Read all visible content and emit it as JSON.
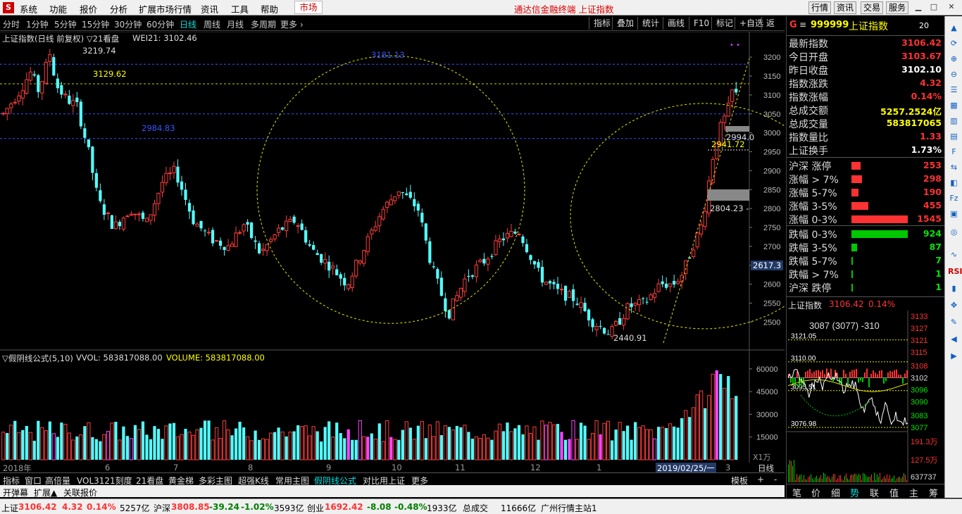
{
  "menu": {
    "logo": "S",
    "items": [
      "系统",
      "功能",
      "报价",
      "分析",
      "扩展市场行情",
      "资讯",
      "工具",
      "帮助"
    ],
    "market": "市场",
    "title": "通达信金融终端  上证指数",
    "right_buttons": [
      "行情",
      "资讯",
      "交易",
      "服务"
    ]
  },
  "periods": [
    "分时",
    "1分钟",
    "5分钟",
    "15分钟",
    "30分钟",
    "60分钟",
    "日线",
    "周线",
    "月线",
    "多周期",
    "更多 ›"
  ],
  "active_period": "日线",
  "chart_tools": [
    "指标",
    "叠加",
    "统计",
    "画线",
    "F10",
    "标记",
    "+自选",
    "返回"
  ],
  "chart_header": {
    "name": "上证指数(日线 前复权) ▽21看盘",
    "wei": "WEI21: 3102.46"
  },
  "price_axis": [
    "3200",
    "3150",
    "3100",
    "3050",
    "3000",
    "2950",
    "2900",
    "2850",
    "2800",
    "2750",
    "2700",
    "2650",
    "2600",
    "2550",
    "2500"
  ],
  "annotations": {
    "high": "3219.74",
    "level1": "3129.62",
    "level2": "2984.83",
    "level3": "3181.13",
    "low": "2440.91",
    "mark1": "2941.72",
    "mark2": "2994.0",
    "mark3": "2804.23 -",
    "cursor_price": "2617.3"
  },
  "volume": {
    "header": "▽假阴线公式(5,10)",
    "vvol": "VVOL: 583817088.00",
    "volume": "VOLUME: 583817088.00",
    "axis": [
      "60000",
      "45000",
      "30000",
      "15000"
    ],
    "unit": "X1万"
  },
  "date_axis": [
    "2018年",
    "6",
    "7",
    "8",
    "9",
    "10",
    "11",
    "12",
    "1",
    "2019/02/25/一",
    "3"
  ],
  "date_corner": "日线",
  "indicator_tabs": [
    "指标",
    "窗口",
    "高倍量",
    "VOL3121刻度",
    "21看盘",
    "黄金梯",
    "多彩主图",
    "超强K线",
    "常用主图",
    "假阴线公式",
    "对比用上证",
    "更多"
  ],
  "active_indicator": "假阴线公式",
  "indicator_right": [
    "模板",
    "+",
    "-"
  ],
  "sub_tabs": [
    "开弹幕",
    "扩展▲",
    "关联报价"
  ],
  "panel": {
    "code": "999999",
    "name": "上证指数",
    "badge": "20",
    "quotes": [
      {
        "label": "最新指数",
        "value": "3106.42",
        "color": "red"
      },
      {
        "label": "今日开盘",
        "value": "3103.67",
        "color": "red"
      },
      {
        "label": "昨日收盘",
        "value": "3102.10",
        "color": "white"
      },
      {
        "label": "指数涨跌",
        "value": "4.32",
        "color": "red"
      },
      {
        "label": "指数涨幅",
        "value": "0.14%",
        "color": "red"
      },
      {
        "label": "总成交额",
        "value": "5257.2524亿",
        "color": "yellow"
      },
      {
        "label": "总成交量",
        "value": "583817065",
        "color": "yellow"
      },
      {
        "label": "指数量比",
        "value": "1.33",
        "color": "red"
      },
      {
        "label": "上证换手",
        "value": "1.73%",
        "color": "white"
      }
    ],
    "up_stats": [
      {
        "label": "沪深 涨停",
        "value": "253"
      },
      {
        "label": "涨幅 > 7%",
        "value": "298"
      },
      {
        "label": "涨幅 5-7%",
        "value": "190"
      },
      {
        "label": "涨幅 3-5%",
        "value": "455"
      },
      {
        "label": "涨幅 0-3%",
        "value": "1545"
      }
    ],
    "down_stats": [
      {
        "label": "跌幅 0-3%",
        "value": "924"
      },
      {
        "label": "跌幅 3-5%",
        "value": "87"
      },
      {
        "label": "跌幅 5-7%",
        "value": "7"
      },
      {
        "label": "跌幅 > 7%",
        "value": "1"
      },
      {
        "label": "沪深 跌停",
        "value": "1"
      }
    ],
    "mini_title": "上证指数",
    "mini_price": "3106.42",
    "mini_pct": "0.14%",
    "mini_axis": [
      "3133",
      "3127",
      "3121",
      "3115",
      "3108",
      "3102",
      "3096",
      "3090",
      "3083",
      "3077"
    ],
    "mini_left": [
      "3121.05",
      "3110.00",
      "3095.51",
      "3076.98"
    ],
    "mini_header": "3087 (3077) -310",
    "mini_vol_axis": [
      "191.3万",
      "127.5万",
      "637737"
    ],
    "tabs": [
      "笔",
      "价",
      "细",
      "势",
      "联",
      "值",
      "主",
      "筹"
    ],
    "active_tab": "势"
  },
  "status": {
    "sh_name": "上证",
    "sh_price": "3106.42",
    "sh_chg": "4.32",
    "sh_pct": "0.14%",
    "sh_amt": "5257亿",
    "hs_name": "沪深",
    "hs_price": "3808.85",
    "hs_chg": "-39.24",
    "hs_pct": "-1.02%",
    "hs_amt": "3593亿",
    "cy_name": "创业",
    "cy_price": "1692.42",
    "cy_chg": "-8.08",
    "cy_pct": "-0.48%",
    "cy_amt": "1933亿",
    "total_label": "总成交",
    "total": "11666亿",
    "server": "广州行情主站1"
  }
}
